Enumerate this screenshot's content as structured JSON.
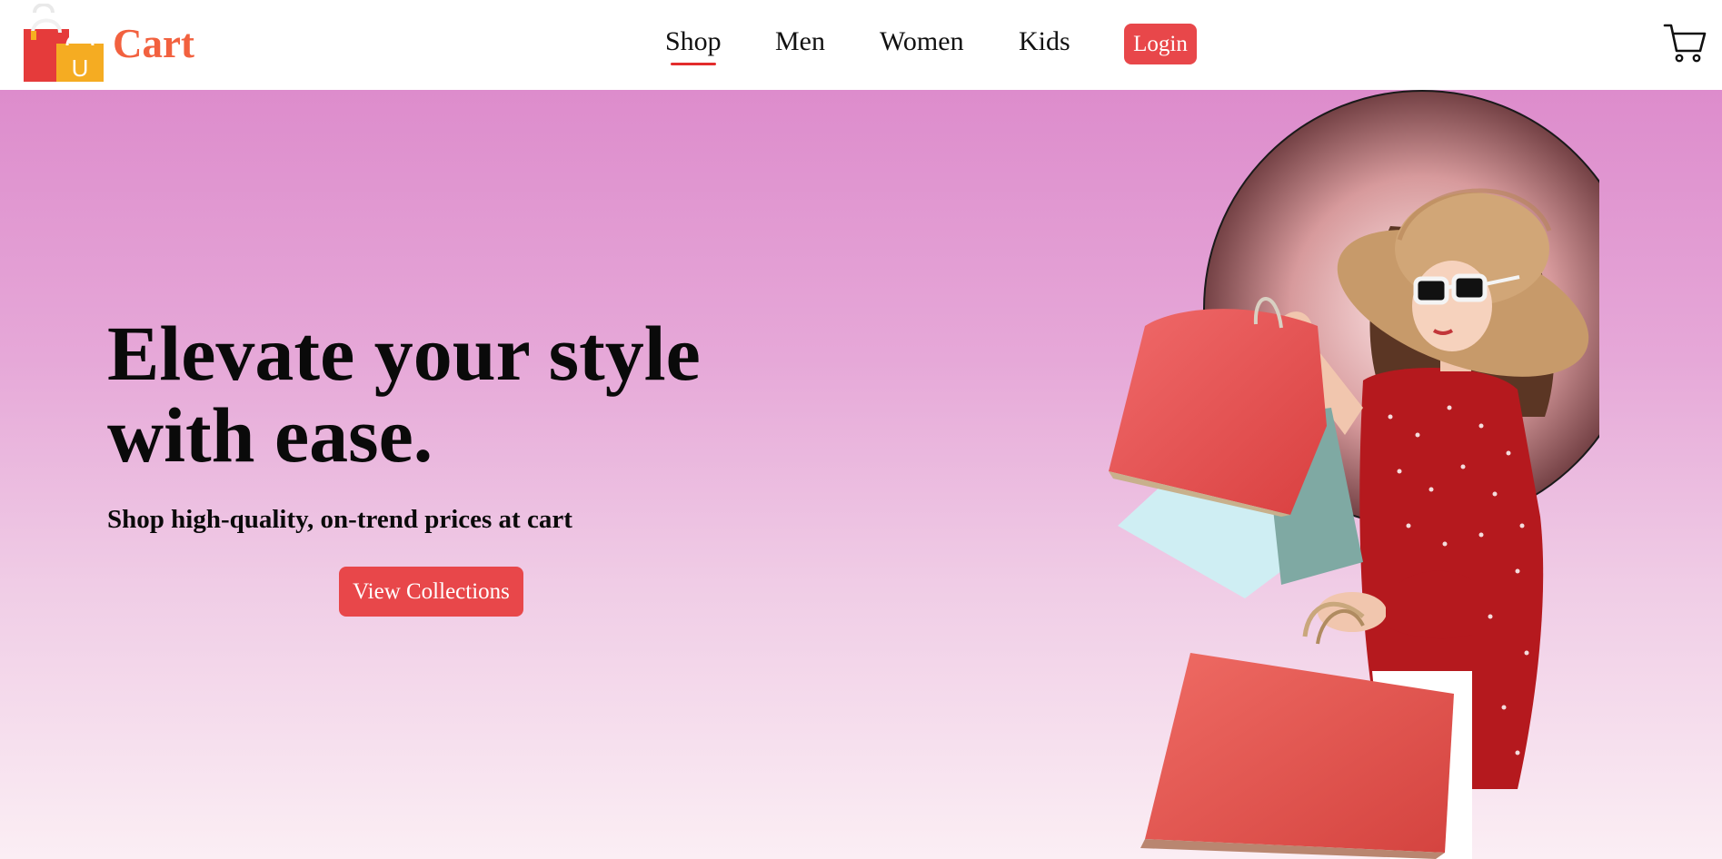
{
  "header": {
    "brand": "Cart",
    "logo_letter": "U",
    "nav": [
      {
        "label": "Shop",
        "active": true
      },
      {
        "label": "Men",
        "active": false
      },
      {
        "label": "Women",
        "active": false
      },
      {
        "label": "Kids",
        "active": false
      }
    ],
    "login_label": "Login",
    "cart_icon": "shopping-cart-icon"
  },
  "hero": {
    "title_line1": "Elevate your style",
    "title_line2": "with ease.",
    "subtitle": "Shop high-quality, on-trend prices at cart",
    "cta_label": "View Collections"
  },
  "colors": {
    "accent": "#e8474a",
    "brand": "#f2613f",
    "hero_gradient_top": "#dd8ccc",
    "hero_gradient_bottom": "#fbeef4"
  }
}
